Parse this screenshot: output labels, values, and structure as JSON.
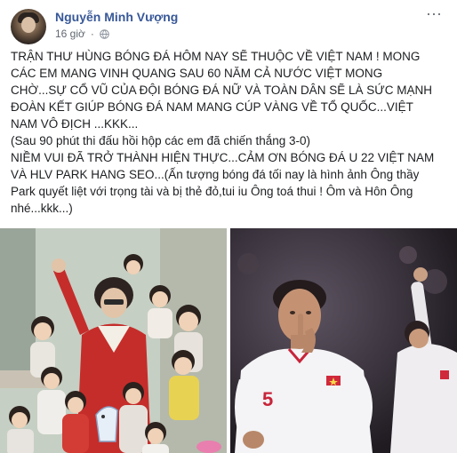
{
  "post": {
    "author": "Nguyễn Minh Vượng",
    "time": "16 giờ",
    "more": "···",
    "icons": {
      "avatar": "profile-avatar",
      "privacy": "globe-icon",
      "menu": "more-options-icon"
    },
    "text_lines": [
      "TRẬN THƯ HÙNG BÓNG ĐÁ HÔM NAY SẼ THUỘC VỀ VIỆT NAM ! MONG",
      "CÁC EM MANG VINH QUANG SAU 60 NĂM CẢ NƯỚC VIỆT MONG",
      "CHỜ...SỰ CỔ VŨ CỦA ĐỘI BÓNG ĐÁ NỮ VÀ TOÀN DÂN SẼ LÀ SỨC MẠNH",
      "ĐOÀN KẾT GIÚP BÓNG ĐÁ NAM MANG CÚP VÀNG VỀ TỔ QUỐC...VIỆT",
      "NAM VÔ ĐỊCH ...KKK...",
      "(Sau 90 phút thi đấu hồi hộp các em đã chiến thắng 3-0)",
      "NIỀM VUI ĐÃ TRỞ THÀNH HIỆN THỰC...CẢM ƠN BÓNG ĐÁ U 22 VIỆT NAM",
      "VÀ HLV PARK HANG SEO...(Ấn tượng bóng đá tối nay là hình ảnh Ông thầy",
      "Park quyết liệt với trọng tài và bị thẻ đỏ,tui iu Ông toá thui ! Ôm và Hôn Ông",
      "nhé...kkk...)"
    ],
    "photos": {
      "left": {
        "subject": "group-photo-children"
      },
      "right": {
        "subject": "football-player-celebration",
        "jersey_number": "5"
      }
    }
  }
}
